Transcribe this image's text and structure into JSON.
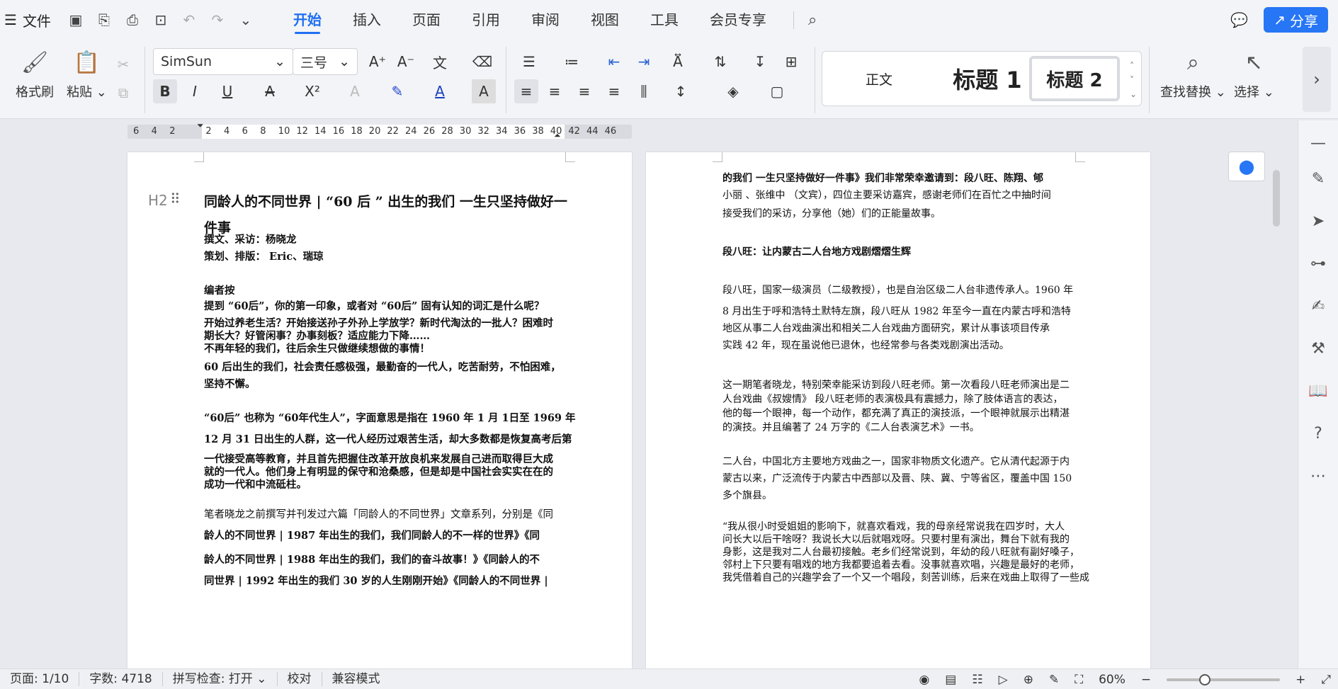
{
  "menubar": {
    "file_label": "文件",
    "tabs": [
      "开始",
      "插入",
      "页面",
      "引用",
      "审阅",
      "视图",
      "工具",
      "会员专享"
    ],
    "active_tab": "开始",
    "share_label": "分享"
  },
  "ribbon": {
    "format_painter": "格式刷",
    "paste": "粘贴",
    "font_name": "SimSun",
    "font_size": "三号",
    "styles": {
      "normal": "正文",
      "heading1": "标题 1",
      "heading2": "标题 2"
    },
    "find_replace": "查找替换",
    "select": "选择"
  },
  "ruler": {
    "ticks": [
      "6",
      "4",
      "2",
      "",
      "2",
      "4",
      "6",
      "8",
      "10",
      "12",
      "14",
      "16",
      "18",
      "20",
      "22",
      "24",
      "26",
      "28",
      "30",
      "32",
      "34",
      "36",
      "38",
      "40",
      "42",
      "44",
      "46"
    ]
  },
  "page1": {
    "heading_marker": "H2",
    "title": "同龄人的不同世界 | “60 后 ” 出生的我们 一生只坚持做好一件事",
    "lines": [
      "撰文、采访：杨晓龙",
      "策划、排版： Eric、瑞琼",
      "编者按",
      "提到 “60后”，你的第一印象，或者对 “60后” 固有认知的词汇是什么呢？",
      "开始过养老生活？开始接送孙子外孙上学放学？新时代淘汰的一批人？困难时",
      "期长大？好管闲事？办事刻板？适应能力下降……",
      "不再年轻的我们，往后余生只做继续想做的事情！",
      "60 后出生的我们，社会责任感极强，最勤奋的一代人，吃苦耐劳，不怕困难，",
      "坚持不懈。",
      "“60后” 也称为 “60年代生人”，字面意思是指在 1960 年 1 月 1日至 1969 年",
      "12 月 31 日出生的人群，这一代人经历过艰苦生活，却大多数都是恢复高考后第",
      "一代接受高等教育，并且首先把握住改革开放良机来发展自己进而取得巨大成",
      "就的一代人。他们身上有明显的保守和沧桑感，但是却是中国社会实实在在的",
      "成功一代和中流砥柱。",
      "笔者晓龙之前撰写并刊发过六篇「同龄人的不同世界」文章系列，分别是《同",
      "龄人的不同世界 | 1987 年出生的我们，我们同龄人的不一样的世界》《同",
      "龄人的不同世界 | 1988 年出生的我们，我们的奋斗故事！》《同龄人的不",
      "同世界 | 1992 年出生的我们 30 岁的人生刚刚开始》《同龄人的不同世界 |"
    ]
  },
  "page2": {
    "lines": [
      "的我们 一生只坚持做好一件事》我们非常荣幸邀请到：段八旺、陈翔、郇",
      "小丽 、张维中 （文宾），四位主要采访嘉宾，感谢老师们在百忙之中抽时间",
      "接受我们的采访，分享他（她）们的正能量故事。",
      "段八旺：让内蒙古二人台地方戏剧熠熠生辉",
      "段八旺，国家一级演员（二级教授），也是自治区级二人台非遗传承人。1960 年",
      "8 月出生于呼和浩特土默特左旗，段八旺从 1982 年至今一直在内蒙古呼和浩特",
      "地区从事二人台戏曲演出和相关二人台戏曲方面研究，累计从事该项目传承",
      "实践 42 年，现在虽说他已退休，也经常参与各类戏剧演出活动。",
      "这一期笔者晓龙，特别荣幸能采访到段八旺老师。第一次看段八旺老师演出是二",
      "人台戏曲《叔嫂情》 段八旺老师的表演极具有震撼力，除了肢体语言的表达，",
      "他的每一个眼神，每一个动作，都充满了真正的演技派，一个眼神就展示出精湛",
      "的演技。并且编著了 24 万字的《二人台表演艺术》一书。",
      "二人台，中国北方主要地方戏曲之一，国家非物质文化遗产。它从清代起源于内",
      "蒙古以来，广泛流传于内蒙古中西部以及晋、陕、冀、宁等省区，覆盖中国 150",
      "多个旗县。",
      "“我从很小时受姐姐的影响下，就喜欢看戏，我的母亲经常说我在四岁时，大人",
      "问长大以后干啥呀？我说长大以后就唱戏呀。只要村里有演出，舞台下就有我的",
      "身影，这是我对二人台最初接触。老乡们经常说到，年幼的段八旺就有副好嗓子，",
      "邻村上下只要有唱戏的地方我都要追着去看。没事就喜欢唱，兴趣是最好的老师，",
      "我凭借着自己的兴趣学会了一个又一个唱段，刻苦训练，后来在戏曲上取得了一些成"
    ]
  },
  "statusbar": {
    "page": "页面: 1/10",
    "words": "字数: 4718",
    "spell": "拼写检查: 打开",
    "proof": "校对",
    "compat": "兼容模式",
    "zoom": "60%"
  }
}
